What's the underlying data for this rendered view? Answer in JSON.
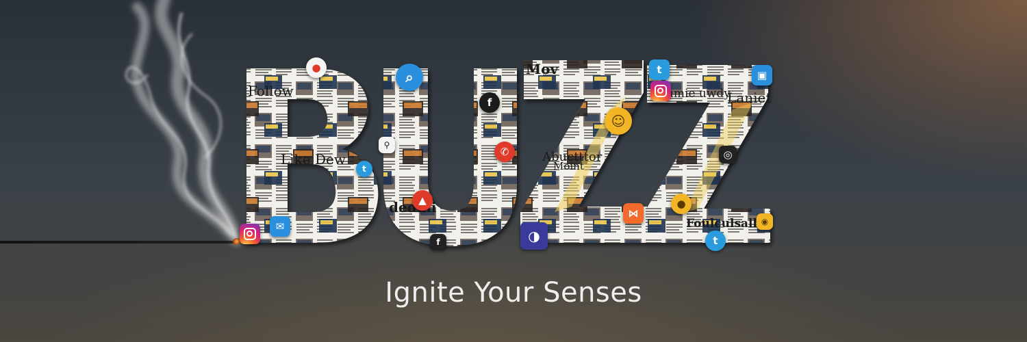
{
  "banner": {
    "title": "BUZZ",
    "tagline": "Ignite Your Senses"
  },
  "collage": {
    "headlines": [
      "Follow",
      "Like Dew",
      "Mov",
      "Laniet",
      "Foulculsalb",
      "dedmi",
      "Abuctttor",
      "Moint",
      "deumie uwdy"
    ]
  },
  "icons": [
    "instagram-icon",
    "twitter-icon",
    "facebook-icon",
    "search-icon",
    "phone-icon",
    "mail-icon",
    "smiley-icon",
    "location-icon",
    "message-icon"
  ],
  "colors": {
    "background_top": "#2a3038",
    "background_glow": "#96694a",
    "tagline": "#eeeeee",
    "twitter": "#2a9bdf",
    "instagram": "#d2227a"
  }
}
